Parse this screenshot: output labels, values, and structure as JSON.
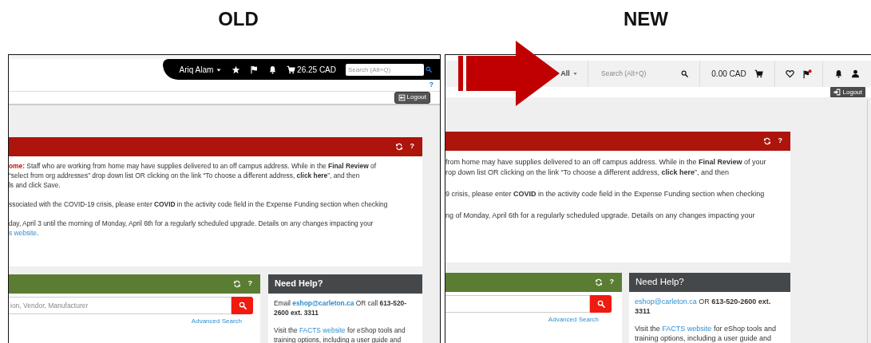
{
  "old_screen": {
    "heading": "OLD",
    "top_bar": {
      "user_name": "Ariq Alam",
      "cart_total": "26.25 CAD",
      "search": {
        "placeholder": "Search (Alt+Q)"
      }
    },
    "help_link": "?",
    "logout": "Logout",
    "notice": {
      "help": "?",
      "paragraphs": [
        [
          [
            {
              "kind": "alert",
              "text": "ome:"
            },
            {
              "kind": "text",
              "text": " Staff who are working from home may have supplies delivered to an off campus address. While in the **Final Review** of"
            }
          ],
          [
            {
              "kind": "text",
              "text": "“select from org addresses” drop down list OR clicking on the link “To choose a different address, **click here**”, and then"
            }
          ],
          [
            {
              "kind": "text",
              "text": "ls and click Save."
            }
          ]
        ],
        [
          [
            {
              "kind": "text",
              "text": "ssociated with the COVID-19 crisis, please enter **COVID** in the activity code field in the Expense Funding section when checking"
            }
          ]
        ],
        [
          [
            {
              "kind": "text",
              "text": "day, April 3 until the morning of Monday, April 6th for a regularly scheduled upgrade.  Details on any changes impacting your"
            }
          ],
          [
            {
              "kind": "link",
              "text": "s website"
            },
            {
              "kind": "text",
              "text": "."
            }
          ]
        ]
      ]
    },
    "search_card": {
      "help": "?",
      "search": {
        "placeholder": "ion, Vendor, Manufacturer"
      },
      "advanced_link": "Advanced Search"
    },
    "help_card": {
      "title": "Need Help?",
      "paragraphs": [
        [
          {
            "kind": "text",
            "text": "Email "
          },
          {
            "kind": "link",
            "text": "**eshop@carleton.ca**"
          },
          {
            "kind": "text",
            "text": " OR call **613-520-2600 ext. 3311**"
          }
        ],
        [
          {
            "kind": "text",
            "text": "Visit the "
          },
          {
            "kind": "link",
            "text": "FACTS website"
          },
          {
            "kind": "text",
            "text": " for eShop tools and training options, including a user guide and"
          }
        ]
      ]
    }
  },
  "new_screen": {
    "heading": "NEW",
    "top_bar": {
      "scope": "All",
      "search": {
        "placeholder": "Search (Alt+Q)"
      },
      "cart_total": "0.00 CAD"
    },
    "logout": "Logout",
    "notice": {
      "help": "?",
      "paragraphs": [
        [
          [
            {
              "kind": "text",
              "text": "from home may have supplies delivered to an off campus address. While in the **Final Review** of your"
            }
          ],
          [
            {
              "kind": "text",
              "text": "rop down list OR clicking on the link “To choose a different address, **click here**”, and then"
            }
          ]
        ],
        [
          [
            {
              "kind": "text",
              "text": "9 crisis, please enter **COVID** in the activity code field in the Expense Funding section when checking"
            }
          ]
        ],
        [
          [
            {
              "kind": "text",
              "text": "ng of Monday, April 6th for a regularly scheduled upgrade.  Details on any changes impacting your"
            }
          ]
        ]
      ]
    },
    "search_card": {
      "help": "?",
      "advanced_link": "Advanced Search"
    },
    "help_card": {
      "title": "Need Help?",
      "paragraphs": [
        [
          {
            "kind": "link",
            "text": "eshop@carleton.ca"
          },
          {
            "kind": "text",
            "text": " OR **613-520-2600 ext. 3311**"
          }
        ],
        [
          {
            "kind": "text",
            "text": "Visit the "
          },
          {
            "kind": "link",
            "text": "FACTS website"
          },
          {
            "kind": "text",
            "text": " for eShop tools and training options, including a user guide and"
          }
        ]
      ]
    }
  }
}
